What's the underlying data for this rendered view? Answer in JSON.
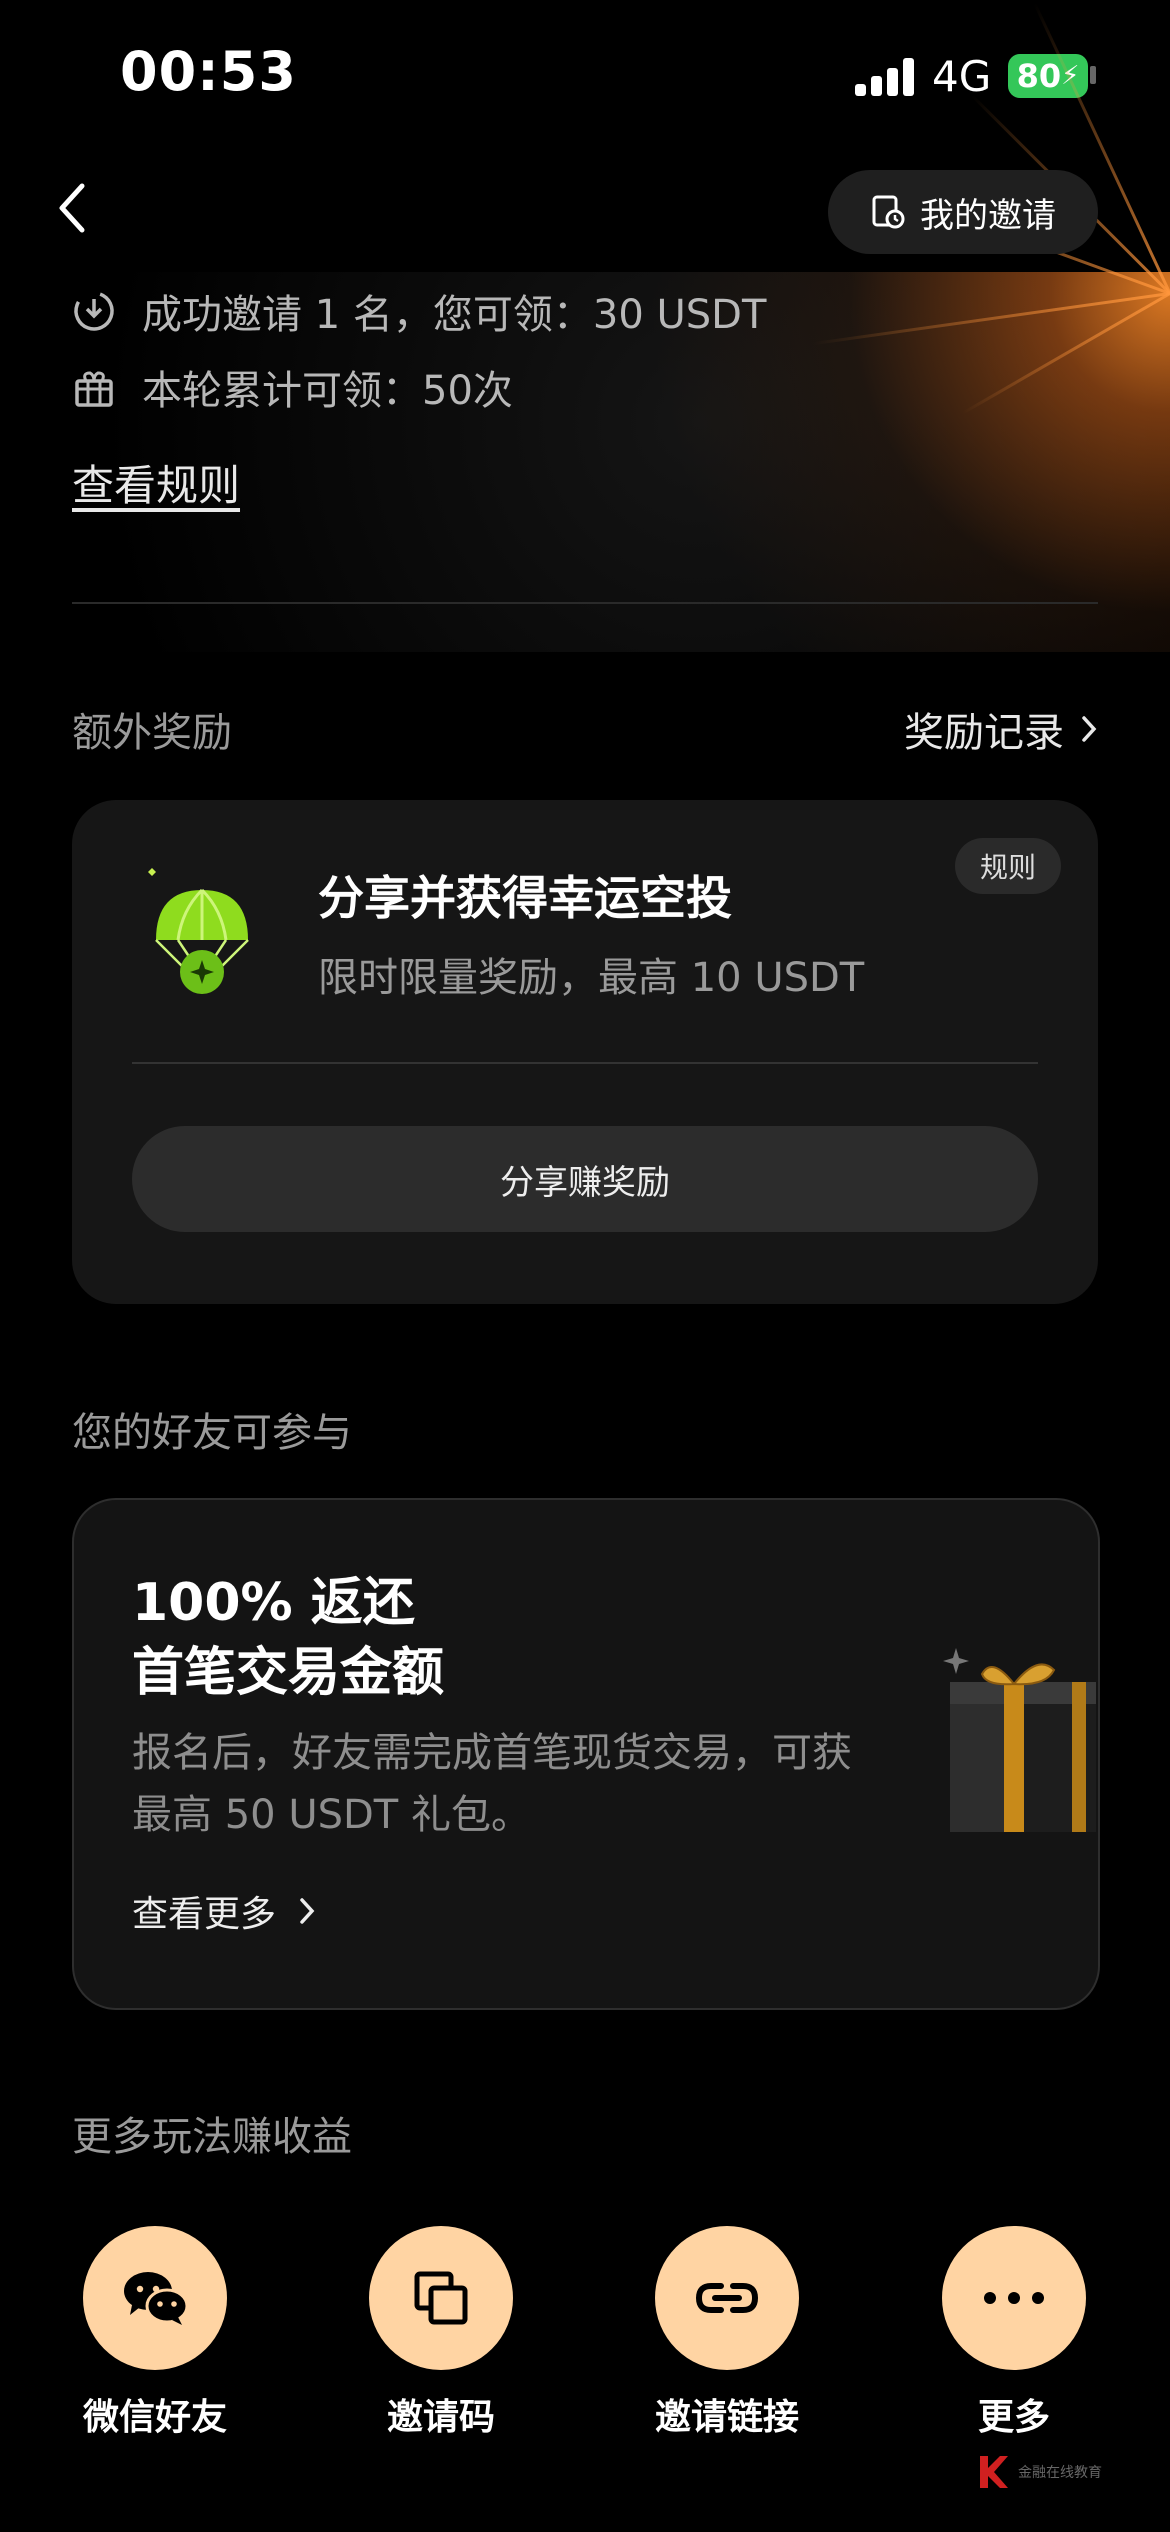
{
  "status_bar": {
    "time": "00:53",
    "network": "4G",
    "battery": "80"
  },
  "header": {
    "my_invite_label": "我的邀请"
  },
  "hero": {
    "lines": [
      {
        "icon": "download-circle-icon",
        "text": "成功邀请 1 名，您可领：30 USDT"
      },
      {
        "icon": "gift-icon",
        "text": "本轮累计可领：50次"
      }
    ],
    "rules_link": "查看规则"
  },
  "extra_rewards": {
    "title": "额外奖励",
    "records_label": "奖励记录",
    "card": {
      "badge": "规则",
      "title": "分享并获得幸运空投",
      "subtitle": "限时限量奖励，最高 10 USDT",
      "button": "分享赚奖励"
    }
  },
  "friends": {
    "title": "您的好友可参与",
    "card": {
      "title_line1": "100% 返还",
      "title_line2": "首笔交易金额",
      "desc": "报名后，好友需完成首笔现货交易，可获最高 50 USDT 礼包。",
      "more": "查看更多"
    }
  },
  "more_ways": {
    "title": "更多玩法赚收益",
    "items": [
      {
        "label": "微信好友",
        "icon": "wechat-icon"
      },
      {
        "label": "邀请码",
        "icon": "copy-icon"
      },
      {
        "label": "邀请链接",
        "icon": "link-icon"
      },
      {
        "label": "更多",
        "icon": "more-dots-icon"
      }
    ]
  },
  "watermark": "金融在线教育",
  "colors": {
    "accent_peach": "#ffd4a3",
    "battery_green": "#34c759",
    "airdrop_green": "#8fdc1e"
  }
}
